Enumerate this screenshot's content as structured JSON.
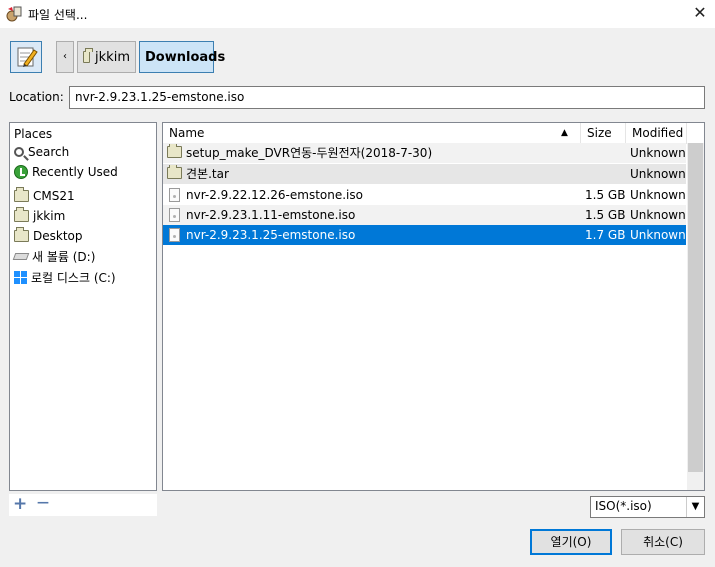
{
  "window": {
    "title": "파일 선택..."
  },
  "pathbar": {
    "back_label": "‹",
    "crumbs": [
      "jkkim",
      "Downloads"
    ]
  },
  "location": {
    "label": "Location:",
    "value": "nvr-2.9.23.1.25-emstone.iso"
  },
  "places": {
    "header": "Places",
    "items": [
      {
        "label": "Search",
        "icon": "search-icon"
      },
      {
        "label": "Recently Used",
        "icon": "recent-icon"
      },
      {
        "label": "CMS21",
        "icon": "folder-icon"
      },
      {
        "label": "jkkim",
        "icon": "folder-icon"
      },
      {
        "label": "Desktop",
        "icon": "folder-icon"
      },
      {
        "label": "새 볼륨 (D:)",
        "icon": "drive-icon"
      },
      {
        "label": "로컬 디스크 (C:)",
        "icon": "windows-drive-icon"
      }
    ],
    "add_label": "+",
    "remove_label": "—"
  },
  "filelist": {
    "columns": {
      "name": "Name",
      "size": "Size",
      "modified": "Modified",
      "sort_indicator": "▲"
    },
    "rows": [
      {
        "name": "setup_make_DVR연동-두원전자(2018-7-30)",
        "size": "",
        "modified": "Unknown",
        "type": "folder"
      },
      {
        "name": "견본.tar",
        "size": "",
        "modified": "Unknown",
        "type": "folder"
      },
      {
        "name": "nvr-2.9.22.12.26-emstone.iso",
        "size": "1.5 GB",
        "modified": "Unknown",
        "type": "file"
      },
      {
        "name": "nvr-2.9.23.1.11-emstone.iso",
        "size": "1.5 GB",
        "modified": "Unknown",
        "type": "file"
      },
      {
        "name": "nvr-2.9.23.1.25-emstone.iso",
        "size": "1.7 GB",
        "modified": "Unknown",
        "type": "file",
        "selected": true
      }
    ]
  },
  "filter": {
    "value": "ISO(*.iso)",
    "arrow": "▼"
  },
  "buttons": {
    "open": "열기(O)",
    "cancel": "취소(C)",
    "close": "✕"
  },
  "colors": {
    "selection": "#0078d7",
    "accent_border": "#3c7fb1"
  }
}
